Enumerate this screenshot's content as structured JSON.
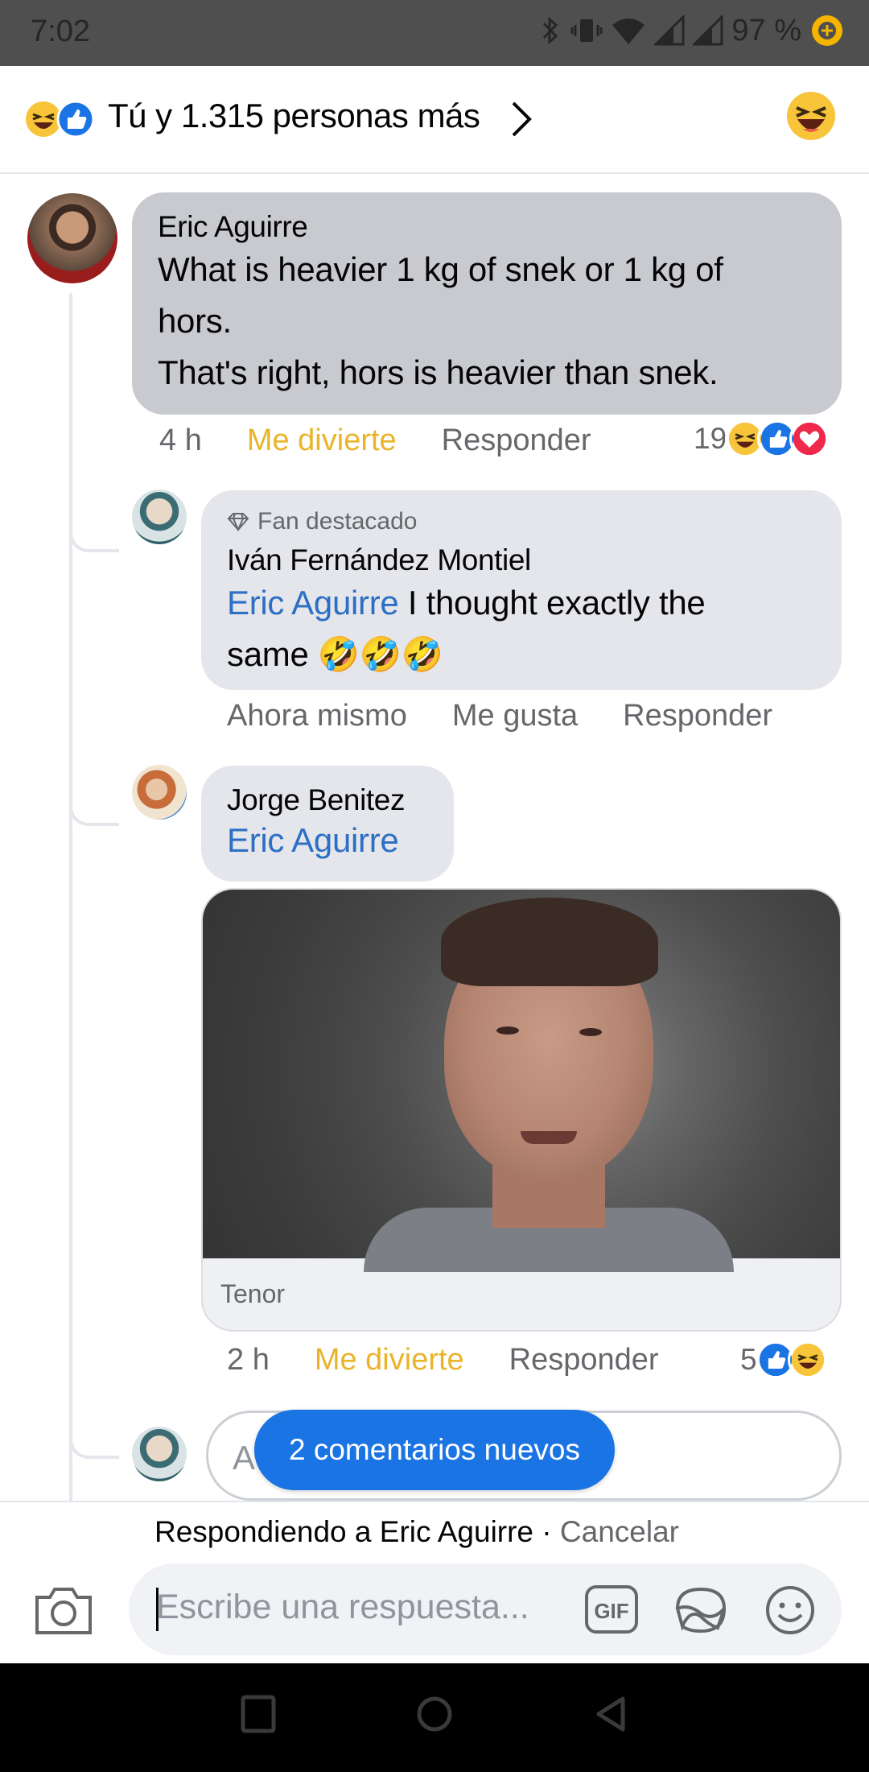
{
  "status_bar": {
    "time": "7:02",
    "battery": "97 %"
  },
  "reactions_header": {
    "summary": "Tú y 1.315 personas más",
    "reaction_icons": [
      "haha-icon",
      "like-icon"
    ]
  },
  "comments": [
    {
      "author": "Eric Aguirre",
      "lines": [
        "What is heavier 1 kg of snek or 1 kg of hors.",
        "That's right, hors is heavier than snek."
      ],
      "time": "4 h",
      "reaction_label": "Me divierte",
      "reply_label": "Responder",
      "reaction_count": "19",
      "reaction_icons": [
        "haha-icon",
        "like-icon",
        "love-icon"
      ]
    }
  ],
  "replies": [
    {
      "badge": "Fan destacado",
      "author": "Iván Fernández Montiel",
      "mention": "Eric Aguirre",
      "text_after_mention": " I thought exactly the",
      "text_line2": "same 🤣🤣🤣",
      "time": "Ahora mismo",
      "like_label": "Me gusta",
      "reply_label": "Responder"
    },
    {
      "author": "Jorge Benitez",
      "mention": "Eric Aguirre",
      "gif_source": "Tenor",
      "time": "2 h",
      "reaction_label": "Me divierte",
      "reply_label": "Responder",
      "reaction_count": "5",
      "reaction_icons": [
        "like-icon",
        "haha-icon"
      ]
    }
  ],
  "reply_input": {
    "placeholder_fragment": "A"
  },
  "new_comments_pill": "2 comentarios nuevos",
  "composer": {
    "replying_prefix": "Respondiendo a ",
    "replying_to": "Eric Aguirre",
    "separator": " · ",
    "cancel": "Cancelar",
    "placeholder": "Escribe una respuesta...",
    "tools": [
      "camera-icon",
      "gif-icon",
      "sticker-icon",
      "emoji-icon"
    ]
  },
  "colors": {
    "accent_blue": "#1b74e4",
    "mention_blue": "#2d6fc4",
    "haha_yellow": "#e9b42a",
    "bubble_grey": "#e4e6eb",
    "highlight_bubble": "#c8cacf"
  }
}
